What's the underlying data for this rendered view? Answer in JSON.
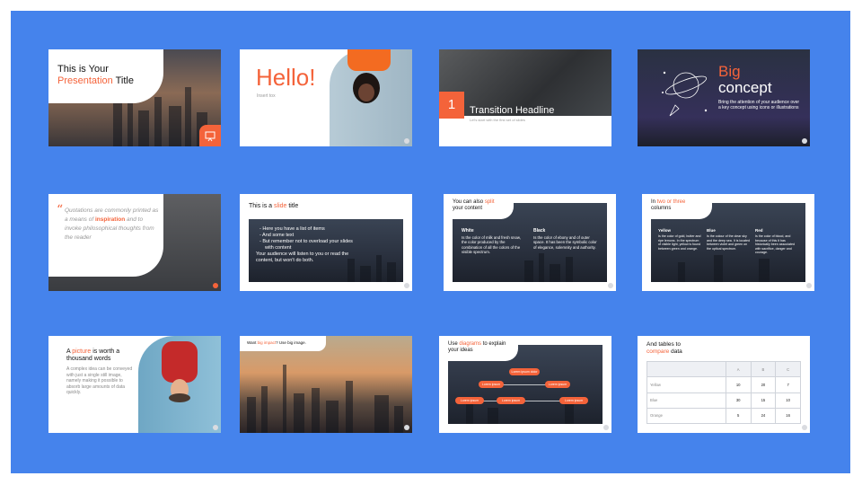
{
  "colors": {
    "accent": "#f4633a",
    "panel": "#4583ec",
    "dark": "#2b3240"
  },
  "s1": {
    "title_a": "This is Your",
    "title_b": "Presentation",
    "title_c": " Title",
    "icon": "presentation-board-icon"
  },
  "s2": {
    "title": "Hello!",
    "sub": "Insert tox"
  },
  "s3": {
    "number": "1",
    "title": "Transition Headline",
    "sub": "Let's start with the first set of slides"
  },
  "s4": {
    "title_a": "Big",
    "title_b": "concept",
    "body": "Bring the attention of your audience over a key concept using icons or illustrations",
    "icon": "planet-rocket-icon"
  },
  "s5": {
    "quote_a": "Quotations are commonly printed as a means of ",
    "quote_b": "inspiration",
    "quote_c": " and to invoke philosophical thoughts from the reader"
  },
  "s6": {
    "title_a": "This is a ",
    "title_b": "slide",
    "title_c": " title",
    "bullets": [
      "Here you have a list of items",
      "And some text",
      "But remember not to overload your slides with content"
    ],
    "body": "Your audience will listen to you or read the content, but won't do both."
  },
  "s7": {
    "title_a": "You can also ",
    "title_b": "split",
    "title_c": "your content",
    "col1_title": "White",
    "col1_body": "Is the color of milk and fresh snow, the color produced by the combination of all the colors of the visible spectrum.",
    "col2_title": "Black",
    "col2_body": "Is the color of ebony and of outer space. It has been the symbolic color of elegance, solemnity and authority."
  },
  "s8": {
    "title_a": "In ",
    "title_b": "two or three",
    "title_c": "columns",
    "cols": [
      {
        "title": "Yellow",
        "body": "Is the color of gold, butter and ripe lemons. In the spectrum of visible light, yellow is found between green and orange."
      },
      {
        "title": "Blue",
        "body": "Is the colour of the clear sky and the deep sea. It is located between violet and green on the optical spectrum."
      },
      {
        "title": "Red",
        "body": "Is the color of blood, and because of this it has historically been associated with sacrifice, danger and courage."
      }
    ]
  },
  "s9": {
    "title_a": "A ",
    "title_b": "picture",
    "title_c": " is worth a thousand words",
    "body": "A complex idea can be conveyed with just a single still image, namely making it possible to absorb large amounts of data quickly."
  },
  "s10": {
    "title_a": "Want ",
    "title_b": "big impact",
    "title_c": "? Use big image."
  },
  "s11": {
    "title_a": "Use ",
    "title_b": "diagrams",
    "title_c": " to explain your ideas",
    "nodes": [
      "Lorem ipsum dolor",
      "Lorem ipsum",
      "Lorem ipsum",
      "Lorem ipsum",
      "Lorem ipsum",
      "Lorem ipsum"
    ]
  },
  "s12": {
    "title_a": "And tables to",
    "title_b": "compare",
    "title_c": " data",
    "headers": [
      "",
      "A",
      "B",
      "C"
    ],
    "rows": [
      [
        "Yellow",
        "10",
        "20",
        "7"
      ],
      [
        "Blue",
        "30",
        "15",
        "10"
      ],
      [
        "Orange",
        "5",
        "24",
        "16"
      ]
    ]
  }
}
